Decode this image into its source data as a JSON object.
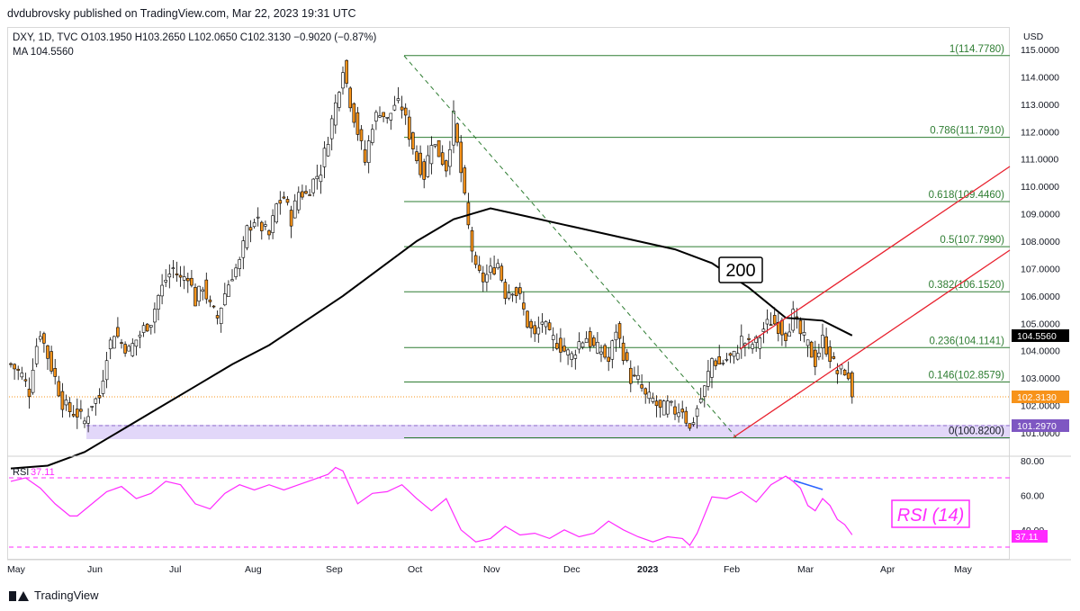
{
  "header": {
    "published": "dvdubrovsky published on TradingView.com, Mar 22, 2023 19:31 UTC",
    "symbol_line": "DXY, 1D, TVC  O103.1950  H103.2650  L102.0650  C102.3130  −0.9020 (−0.87%)",
    "ma_line": "MA  104.5560"
  },
  "footer": {
    "brand": "TradingView"
  },
  "axis": {
    "currency": "USD",
    "price_ticks": [
      "115.0000",
      "114.0000",
      "113.0000",
      "112.0000",
      "111.0000",
      "110.0000",
      "109.0000",
      "108.0000",
      "107.0000",
      "106.0000",
      "105.0000",
      "104.0000",
      "103.0000",
      "102.0000",
      "101.0000"
    ],
    "rsi_ticks": [
      "80.00",
      "60.00",
      "40.00"
    ],
    "month_labels": [
      "May",
      "Jun",
      "Jul",
      "Aug",
      "Sep",
      "Oct",
      "Nov",
      "Dec",
      "2023",
      "Feb",
      "Mar",
      "Apr",
      "May"
    ]
  },
  "badges": {
    "ma_value": "104.5560",
    "close_value": "102.3130",
    "zone_value": "101.2970",
    "rsi_value": "37.11"
  },
  "fib_levels": [
    {
      "label": "1(114.7780)",
      "value": 114.778
    },
    {
      "label": "0.786(111.7910)",
      "value": 111.791
    },
    {
      "label": "0.618(109.4460)",
      "value": 109.446
    },
    {
      "label": "0.5(107.7990)",
      "value": 107.799
    },
    {
      "label": "0.382(106.1520)",
      "value": 106.152
    },
    {
      "label": "0.236(104.1141)",
      "value": 104.1141
    },
    {
      "label": "0.146(102.8579)",
      "value": 102.8579
    },
    {
      "label": "0(100.8200)",
      "value": 100.82
    }
  ],
  "annotations": {
    "ma_period": "200",
    "rsi_title": "RSI (14)",
    "rsi_panel_label": "RSI",
    "rsi_panel_value": "37.11"
  },
  "colors": {
    "bull": "#ffffff",
    "bear": "#f7931a",
    "ma": "#000000",
    "fib": "#2e7d32",
    "channel": "#e8212e",
    "rsi": "#ff2bff",
    "divergence": "#2962ff",
    "zone": "#d8c9f7"
  },
  "chart_data": {
    "type": "candlestick",
    "symbol": "DXY",
    "timeframe": "1D",
    "ohlc_last": {
      "open": 103.195,
      "high": 103.265,
      "low": 102.065,
      "close": 102.313
    },
    "x": [
      "May 2022",
      "Jun",
      "Jul",
      "Aug",
      "Sep",
      "Oct",
      "Nov",
      "Dec",
      "2023",
      "Feb",
      "Mar",
      "Apr",
      "May"
    ],
    "close_path": [
      [
        0,
        103.5
      ],
      [
        3,
        103.1
      ],
      [
        5,
        102.5
      ],
      [
        6,
        103.5
      ],
      [
        7,
        104.2
      ],
      [
        8,
        104.7
      ],
      [
        10,
        103.8
      ],
      [
        12,
        103.0
      ],
      [
        14,
        102.1
      ],
      [
        16,
        101.8
      ],
      [
        18,
        101.7
      ],
      [
        20,
        101.4
      ],
      [
        22,
        102.1
      ],
      [
        24,
        102.3
      ],
      [
        26,
        103.9
      ],
      [
        28,
        104.7
      ],
      [
        30,
        104.3
      ],
      [
        32,
        104.0
      ],
      [
        34,
        104.4
      ],
      [
        36,
        104.8
      ],
      [
        38,
        105.1
      ],
      [
        40,
        106.0
      ],
      [
        42,
        106.6
      ],
      [
        44,
        107.0
      ],
      [
        46,
        106.6
      ],
      [
        48,
        106.8
      ],
      [
        50,
        105.8
      ],
      [
        52,
        106.4
      ],
      [
        54,
        105.6
      ],
      [
        56,
        105.2
      ],
      [
        58,
        106.1
      ],
      [
        60,
        106.8
      ],
      [
        62,
        107.2
      ],
      [
        64,
        108.4
      ],
      [
        66,
        108.8
      ],
      [
        68,
        108.5
      ],
      [
        70,
        108.2
      ],
      [
        72,
        109.3
      ],
      [
        74,
        109.6
      ],
      [
        76,
        108.8
      ],
      [
        78,
        109.8
      ],
      [
        80,
        109.7
      ],
      [
        82,
        110.2
      ],
      [
        84,
        110.6
      ],
      [
        86,
        111.8
      ],
      [
        88,
        113.0
      ],
      [
        90,
        114.4
      ],
      [
        92,
        113.1
      ],
      [
        94,
        112.0
      ],
      [
        96,
        110.9
      ],
      [
        98,
        112.3
      ],
      [
        100,
        112.8
      ],
      [
        102,
        112.4
      ],
      [
        104,
        113.0
      ],
      [
        106,
        112.9
      ],
      [
        108,
        111.9
      ],
      [
        110,
        111.0
      ],
      [
        112,
        110.4
      ],
      [
        114,
        111.7
      ],
      [
        116,
        111.2
      ],
      [
        118,
        110.7
      ],
      [
        120,
        112.5
      ],
      [
        122,
        110.5
      ],
      [
        124,
        108.5
      ],
      [
        126,
        106.9
      ],
      [
        128,
        106.6
      ],
      [
        130,
        106.9
      ],
      [
        132,
        107.2
      ],
      [
        134,
        106.1
      ],
      [
        136,
        106.3
      ],
      [
        138,
        105.9
      ],
      [
        140,
        105.0
      ],
      [
        142,
        104.5
      ],
      [
        144,
        105.1
      ],
      [
        146,
        104.5
      ],
      [
        148,
        104.3
      ],
      [
        150,
        104.0
      ],
      [
        152,
        103.8
      ],
      [
        154,
        104.3
      ],
      [
        156,
        104.5
      ],
      [
        158,
        104.1
      ],
      [
        160,
        104.0
      ],
      [
        162,
        103.6
      ],
      [
        164,
        104.8
      ],
      [
        166,
        103.9
      ],
      [
        168,
        103.0
      ],
      [
        170,
        102.9
      ],
      [
        172,
        102.3
      ],
      [
        174,
        102.2
      ],
      [
        176,
        101.8
      ],
      [
        178,
        102.0
      ],
      [
        180,
        101.8
      ],
      [
        182,
        101.9
      ],
      [
        184,
        101.1
      ],
      [
        186,
        101.9
      ],
      [
        188,
        102.6
      ],
      [
        190,
        103.7
      ],
      [
        192,
        103.5
      ],
      [
        194,
        103.7
      ],
      [
        196,
        103.8
      ],
      [
        198,
        104.4
      ],
      [
        200,
        104.2
      ],
      [
        202,
        104.3
      ],
      [
        204,
        104.8
      ],
      [
        206,
        105.1
      ],
      [
        208,
        104.9
      ],
      [
        210,
        104.6
      ],
      [
        212,
        105.3
      ],
      [
        214,
        104.6
      ],
      [
        216,
        104.2
      ],
      [
        218,
        103.6
      ],
      [
        220,
        104.4
      ],
      [
        222,
        103.8
      ],
      [
        224,
        103.2
      ],
      [
        226,
        103.3
      ],
      [
        228,
        102.3
      ]
    ],
    "ma200": [
      [
        0,
        99.7
      ],
      [
        10,
        99.8
      ],
      [
        20,
        100.3
      ],
      [
        30,
        101.1
      ],
      [
        40,
        101.9
      ],
      [
        50,
        102.7
      ],
      [
        60,
        103.5
      ],
      [
        70,
        104.2
      ],
      [
        80,
        105.1
      ],
      [
        90,
        106.0
      ],
      [
        100,
        107.0
      ],
      [
        110,
        108.0
      ],
      [
        120,
        108.8
      ],
      [
        130,
        109.2
      ],
      [
        140,
        108.9
      ],
      [
        150,
        108.6
      ],
      [
        160,
        108.3
      ],
      [
        170,
        108.0
      ],
      [
        180,
        107.7
      ],
      [
        190,
        107.2
      ],
      [
        200,
        106.3
      ],
      [
        210,
        105.2
      ],
      [
        220,
        105.1
      ],
      [
        228,
        104.556
      ]
    ],
    "rsi14": [
      [
        0,
        68
      ],
      [
        4,
        70
      ],
      [
        8,
        64
      ],
      [
        12,
        55
      ],
      [
        16,
        48
      ],
      [
        18,
        48
      ],
      [
        22,
        55
      ],
      [
        26,
        62
      ],
      [
        30,
        65
      ],
      [
        34,
        58
      ],
      [
        38,
        61
      ],
      [
        42,
        68
      ],
      [
        46,
        66
      ],
      [
        50,
        55
      ],
      [
        54,
        52
      ],
      [
        58,
        61
      ],
      [
        62,
        66
      ],
      [
        66,
        63
      ],
      [
        70,
        66
      ],
      [
        74,
        63
      ],
      [
        78,
        66
      ],
      [
        82,
        69
      ],
      [
        86,
        72
      ],
      [
        88,
        76
      ],
      [
        90,
        74
      ],
      [
        94,
        55
      ],
      [
        98,
        61
      ],
      [
        102,
        62
      ],
      [
        106,
        66
      ],
      [
        110,
        58
      ],
      [
        114,
        51
      ],
      [
        118,
        58
      ],
      [
        122,
        40
      ],
      [
        126,
        33
      ],
      [
        130,
        35
      ],
      [
        134,
        42
      ],
      [
        138,
        37
      ],
      [
        142,
        38
      ],
      [
        146,
        35
      ],
      [
        150,
        40
      ],
      [
        154,
        36
      ],
      [
        158,
        38
      ],
      [
        162,
        45
      ],
      [
        166,
        40
      ],
      [
        170,
        36
      ],
      [
        174,
        33
      ],
      [
        178,
        36
      ],
      [
        182,
        35
      ],
      [
        184,
        31
      ],
      [
        186,
        38
      ],
      [
        190,
        59
      ],
      [
        194,
        58
      ],
      [
        198,
        62
      ],
      [
        202,
        56
      ],
      [
        206,
        66
      ],
      [
        210,
        71
      ],
      [
        212,
        68
      ],
      [
        214,
        64
      ],
      [
        216,
        54
      ],
      [
        218,
        51
      ],
      [
        220,
        58
      ],
      [
        222,
        54
      ],
      [
        224,
        46
      ],
      [
        226,
        43
      ],
      [
        228,
        37.11
      ]
    ],
    "rsi_levels": [
      70,
      30
    ],
    "ylim": [
      100.5,
      115.3
    ],
    "rsi_ylim": [
      26,
      81
    ]
  }
}
